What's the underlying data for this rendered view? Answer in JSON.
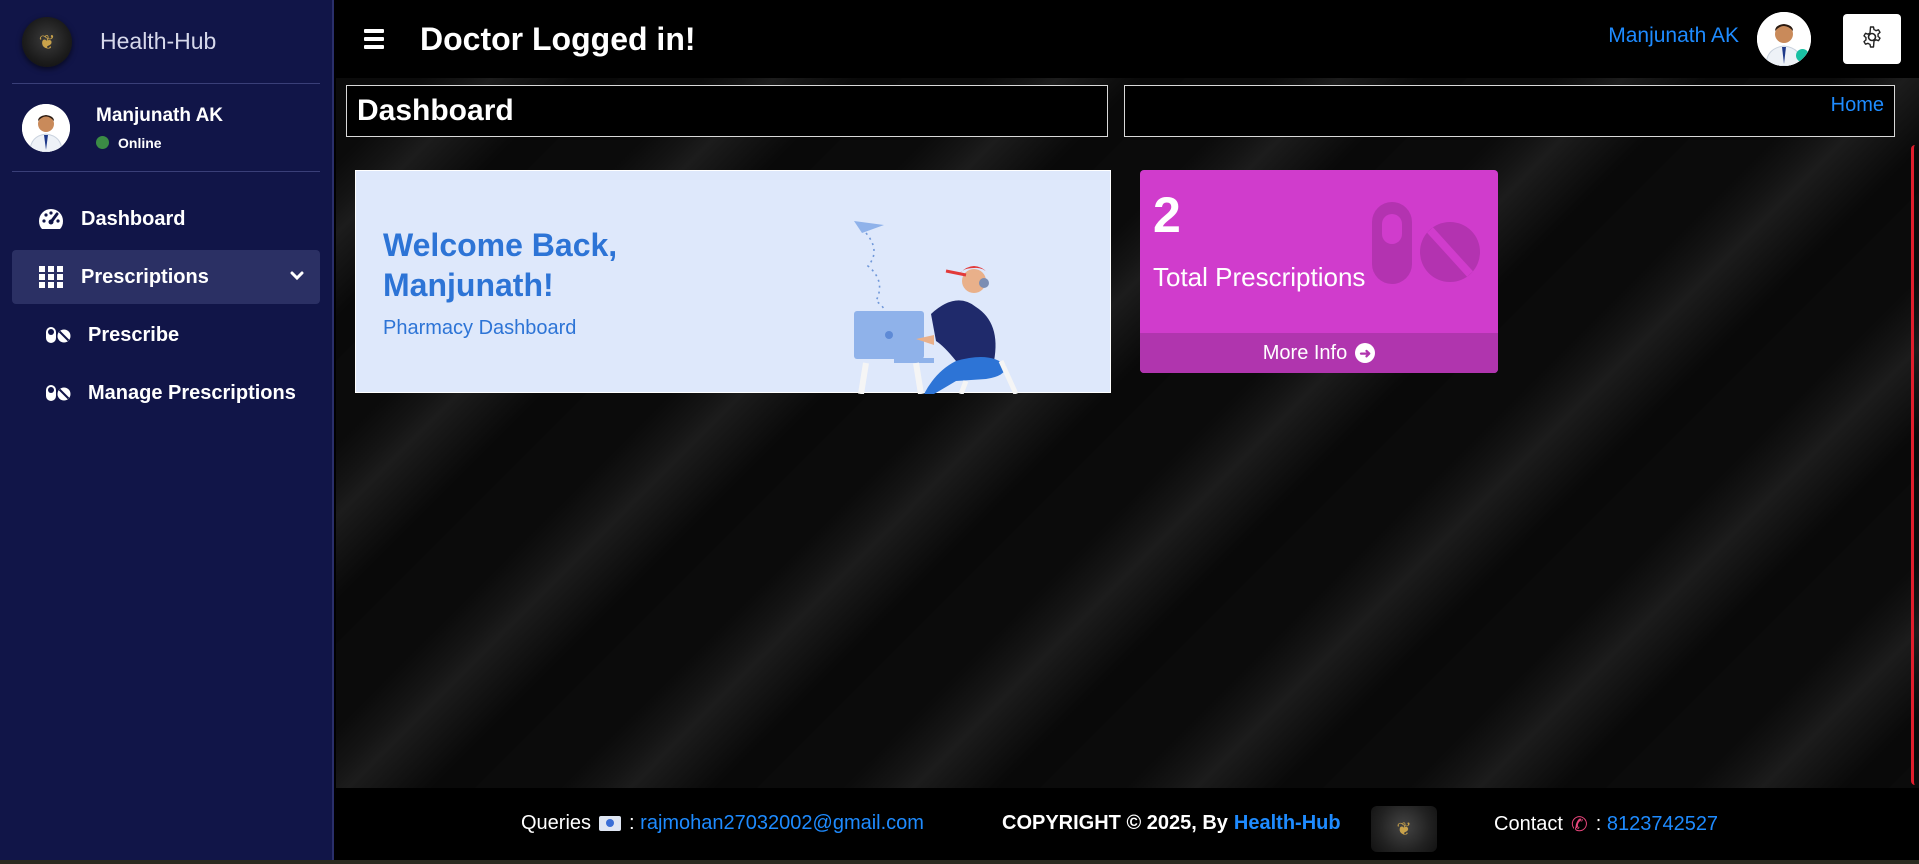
{
  "sidebar": {
    "brand_name": "Health-Hub",
    "user_name": "Manjunath AK",
    "user_status": "Online",
    "items": [
      {
        "label": "Dashboard",
        "icon": "tachometer-icon"
      },
      {
        "label": "Prescriptions",
        "icon": "grid-icon",
        "expanded": true
      },
      {
        "label": "Prescribe",
        "icon": "pills-icon"
      },
      {
        "label": "Manage Prescriptions",
        "icon": "pills-icon"
      }
    ]
  },
  "topbar": {
    "title": "Doctor Logged in!",
    "user_name": "Manjunath AK"
  },
  "content": {
    "page_title": "Dashboard",
    "breadcrumb": "Home",
    "welcome_title": "Welcome Back, Manjunath!",
    "welcome_subtitle": "Pharmacy Dashboard",
    "stat_value": "2",
    "stat_label": "Total Prescriptions",
    "stat_link": "More Info"
  },
  "footer": {
    "queries_label": "Queries",
    "email": "rajmohan27032002@gmail.com",
    "copyright": "COPYRIGHT © 2025, By",
    "copyright_brand": "Health-Hub",
    "contact_label": "Contact",
    "phone": "8123742527"
  },
  "colors": {
    "sidebar_bg": "#111548",
    "accent_link": "#1e8bff",
    "stat_card": "#d03ccc",
    "welcome_bg": "#dee8fb",
    "welcome_text": "#2d74d6",
    "online": "#3b8c45"
  }
}
